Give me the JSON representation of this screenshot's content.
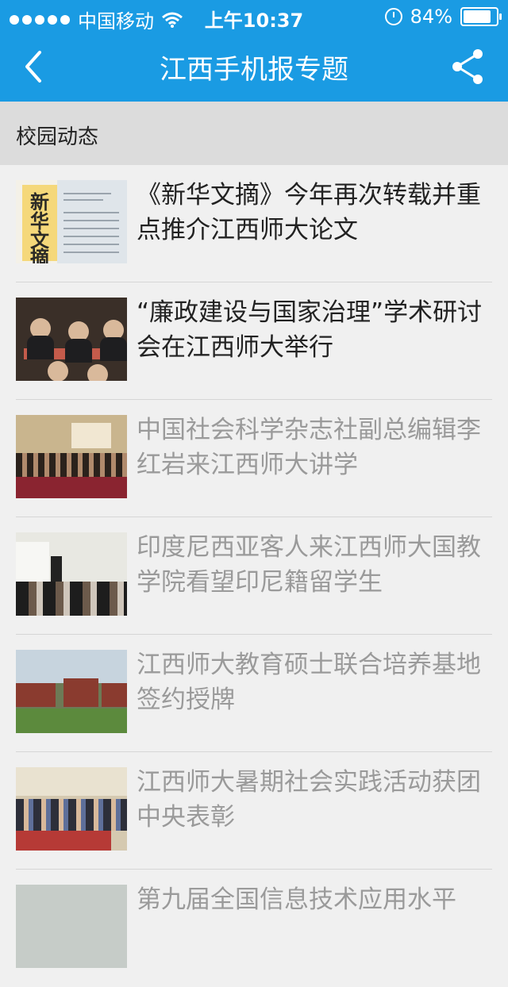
{
  "status": {
    "carrier": "中国移动",
    "time": "上午10:37",
    "battery_text": "84%",
    "battery_level": 0.84
  },
  "nav": {
    "title": "江西手机报专题"
  },
  "section": {
    "title": "校园动态"
  },
  "articles": [
    {
      "title": "《新华文摘》今年再次转载并重点推介江西师大论文",
      "read": false,
      "thumb_text": [
        "新",
        "华",
        "文",
        "摘"
      ]
    },
    {
      "title": "“廉政建设与国家治理”学术研讨会在江西师大举行",
      "read": false
    },
    {
      "title": "中国社会科学杂志社副总编辑李红岩来江西师大讲学",
      "read": true
    },
    {
      "title": "印度尼西亚客人来江西师大国教学院看望印尼籍留学生",
      "read": true
    },
    {
      "title": "江西师大教育硕士联合培养基地签约授牌",
      "read": true
    },
    {
      "title": "江西师大暑期社会实践活动获团中央表彰",
      "read": true
    },
    {
      "title": "第九届全国信息技术应用水平",
      "read": true
    }
  ],
  "colors": {
    "accent": "#1a9be3",
    "read_text": "#9a9a9a",
    "unread_text": "#222222"
  },
  "icons": {
    "back": "chevron-left-icon",
    "share": "share-icon",
    "wifi": "wifi-icon",
    "alarm": "alarm-icon",
    "battery": "battery-icon"
  }
}
